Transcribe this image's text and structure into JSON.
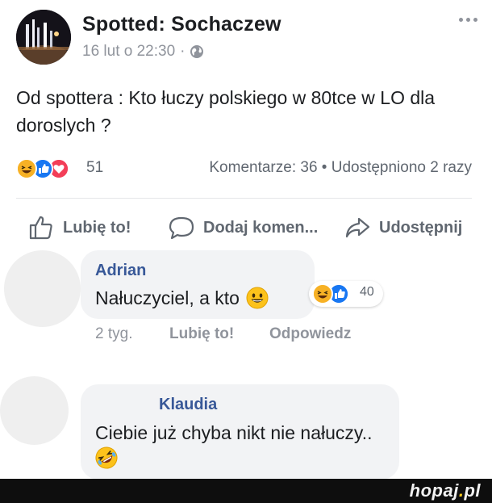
{
  "post": {
    "page_name": "Spotted: Sochaczew",
    "timestamp": "16 lut o 22:30",
    "meta_separator": "·",
    "text": "Od spottera : Kto łuczy polskiego w 80tce w LO dla doroslych ?",
    "reaction_count": "51",
    "stats": "Komentarze: 36 • Udostępniono 2 razy",
    "reaction_icons": [
      "haha-icon",
      "like-icon",
      "love-icon"
    ]
  },
  "actions": {
    "like": "Lubię to!",
    "comment": "Dodaj komen...",
    "share": "Udostępnij"
  },
  "comments": [
    {
      "author": "Adrian",
      "text": "Nałuczyciel, a kto",
      "emoji": "grinning-face-icon",
      "reaction_count": "40",
      "reaction_icons": [
        "haha-icon",
        "like-icon"
      ],
      "time": "2 tyg.",
      "like": "Lubię to!",
      "reply": "Odpowiedz"
    },
    {
      "author": "Klaudia",
      "text": "Ciebie już chyba nikt nie nałuczy..",
      "emoji": "rofl-icon"
    }
  ],
  "watermark": {
    "name": "hopaj",
    "dot": ".",
    "tld": "pl"
  },
  "colors": {
    "link_blue": "#385898",
    "like_blue": "#1877f2",
    "love_red": "#f33e58",
    "haha_yellow": "#f7b125",
    "muted": "#606770"
  }
}
